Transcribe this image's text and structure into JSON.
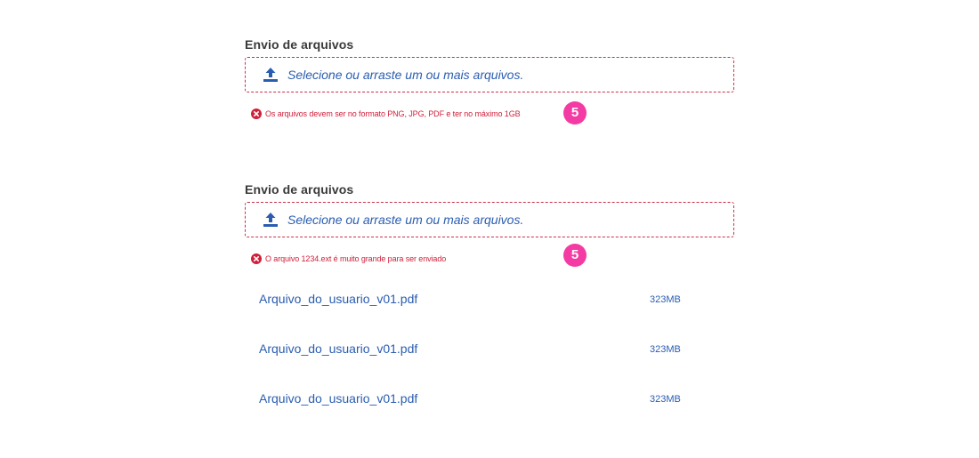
{
  "uploads": [
    {
      "label": "Envio de arquivos",
      "placeholder": "Selecione ou arraste um ou mais arquivos.",
      "error": "Os arquivos devem ser no formato PNG, JPG, PDF e ter no máximo 1GB",
      "marker": "5"
    },
    {
      "label": "Envio de arquivos",
      "placeholder": "Selecione ou arraste um ou mais arquivos.",
      "error": "O arquivo 1234.ext é muito grande para ser enviado",
      "marker": "5"
    }
  ],
  "files": [
    {
      "name": "Arquivo_do_usuario_v01.pdf",
      "size": "323MB"
    },
    {
      "name": "Arquivo_do_usuario_v01.pdf",
      "size": "323MB"
    },
    {
      "name": "Arquivo_do_usuario_v01.pdf",
      "size": "323MB"
    }
  ],
  "colors": {
    "accent": "#2a5db0",
    "error": "#d0203a",
    "dropzone_border": "#c8324a",
    "marker": "#f43ba3"
  },
  "icons": {
    "upload": "upload-icon",
    "error": "error-circle-x-icon"
  }
}
